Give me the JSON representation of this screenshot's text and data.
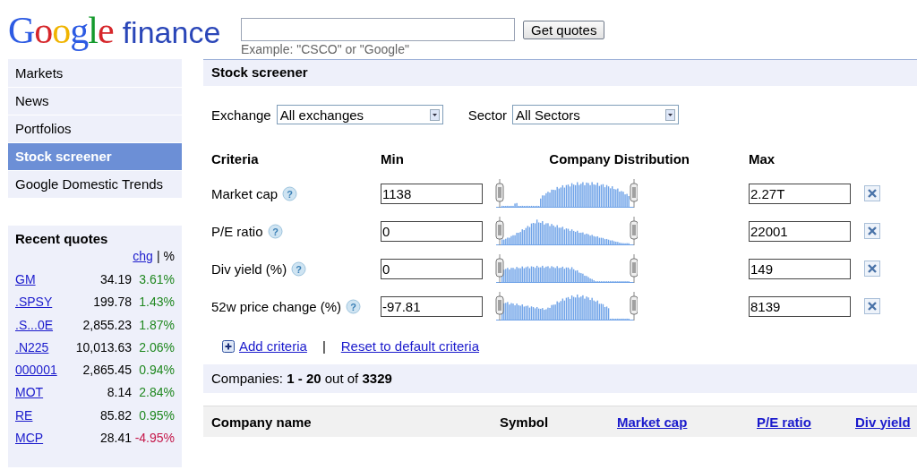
{
  "logo": {
    "brand": "Google",
    "product": "finance"
  },
  "search": {
    "hint": "Example: \"CSCO\" or \"Google\"",
    "button": "Get quotes"
  },
  "nav": [
    {
      "label": "Markets",
      "selected": false
    },
    {
      "label": "News",
      "selected": false
    },
    {
      "label": "Portfolios",
      "selected": false
    },
    {
      "label": "Stock screener",
      "selected": true
    },
    {
      "label": "Google Domestic Trends",
      "selected": false
    }
  ],
  "recent_quotes": {
    "title": "Recent quotes",
    "chg_link": "chg",
    "separator": "|",
    "pct_label": "%",
    "rows": [
      {
        "symbol": "GM",
        "price": "34.19",
        "change": "3.61%",
        "color": "#208820"
      },
      {
        "symbol": ".SPSY",
        "price": "199.78",
        "change": "1.43%",
        "color": "#208820"
      },
      {
        "symbol": ".S...0E",
        "price": "2,855.23",
        "change": "1.87%",
        "color": "#208820"
      },
      {
        "symbol": ".N225",
        "price": "10,013.63",
        "change": "2.06%",
        "color": "#208820"
      },
      {
        "symbol": "000001",
        "price": "2,865.45",
        "change": "0.94%",
        "color": "#208820"
      },
      {
        "symbol": "MOT",
        "price": "8.14",
        "change": "2.84%",
        "color": "#208820"
      },
      {
        "symbol": "RE",
        "price": "85.82",
        "change": "0.95%",
        "color": "#208820"
      },
      {
        "symbol": "MCP",
        "price": "28.41",
        "change": "-4.95%",
        "color": "#c5184a"
      }
    ]
  },
  "screener": {
    "title": "Stock screener",
    "filters": [
      {
        "label": "Exchange",
        "value": "All exchanges"
      },
      {
        "label": "Sector",
        "value": "All Sectors"
      }
    ],
    "columns": [
      "Criteria",
      "Min",
      "Company Distribution",
      "Max"
    ],
    "criteria": [
      {
        "label": "Market cap",
        "help": "?",
        "min": "1138",
        "max": "2.27T"
      },
      {
        "label": "P/E ratio",
        "help": "?",
        "min": "0",
        "max": "22001"
      },
      {
        "label": "Div yield (%)",
        "help": "?",
        "min": "0",
        "max": "149"
      },
      {
        "label": "52w price change (%)",
        "help": "?",
        "min": "-97.81",
        "max": "8139"
      }
    ],
    "add_link": "Add criteria",
    "link_separator": "|",
    "reset_link": "Reset to default criteria",
    "summary": "Companies: **1 - 20** out of **3329**",
    "table_columns": [
      {
        "label": "Company name",
        "sortable": false
      },
      {
        "label": "Symbol",
        "sortable": false
      },
      {
        "label": "Market cap",
        "sortable": true
      },
      {
        "label": "P/E ratio",
        "sortable": true
      },
      {
        "label": "Div yield",
        "sortable": true
      }
    ]
  }
}
